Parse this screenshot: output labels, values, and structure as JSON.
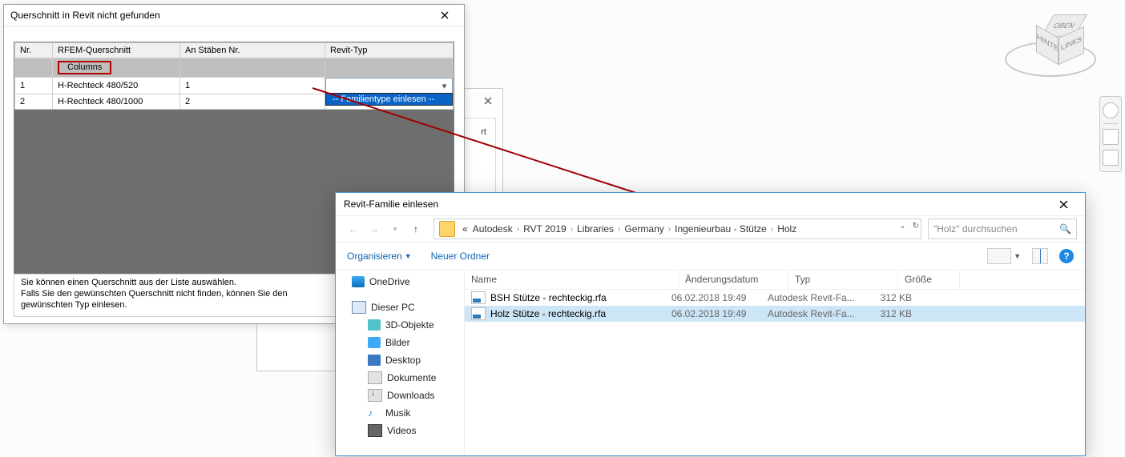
{
  "viewcube": {
    "top": "OBEN",
    "left": "HINTEN",
    "right": "LINKS"
  },
  "dialog1": {
    "title": "Querschnitt in Revit nicht gefunden",
    "columns": {
      "nr": "Nr.",
      "rfem": "RFEM-Querschnitt",
      "staebe": "An Stäben Nr.",
      "revit": "Revit-Typ"
    },
    "group_label": "Columns",
    "rows": [
      {
        "nr": "1",
        "rfem": "H-Rechteck 480/520",
        "staebe": "1"
      },
      {
        "nr": "2",
        "rfem": "H-Rechteck 480/1000",
        "staebe": "2"
      }
    ],
    "dropdown_item": "-- Familientype einlesen --",
    "footer": "Sie können einen Querschnitt aus der Liste auswählen.\nFalls Sie den gewünschten Querschnitt nicht finden, können Sie den gewünschten Typ einlesen."
  },
  "bgwin": {
    "rt": "rt"
  },
  "dialog2": {
    "title": "Revit-Familie einlesen",
    "breadcrumb": [
      "«",
      "Autodesk",
      "RVT 2019",
      "Libraries",
      "Germany",
      "Ingenieurbau - Stütze",
      "Holz"
    ],
    "search_placeholder": "\"Holz\" durchsuchen",
    "organize": "Organisieren",
    "new_folder": "Neuer Ordner",
    "help": "?",
    "tree": {
      "onedrive": "OneDrive",
      "this_pc": "Dieser PC",
      "objects3d": "3D-Objekte",
      "pictures": "Bilder",
      "desktop": "Desktop",
      "documents": "Dokumente",
      "downloads": "Downloads",
      "music": "Musik",
      "videos": "Videos"
    },
    "list_head": {
      "name": "Name",
      "date": "Änderungsdatum",
      "type": "Typ",
      "size": "Größe"
    },
    "files": [
      {
        "name": "BSH Stütze - rechteckig.rfa",
        "date": "06.02.2018 19:49",
        "type": "Autodesk Revit-Fa...",
        "size": "312 KB",
        "selected": false
      },
      {
        "name": "Holz Stütze - rechteckig.rfa",
        "date": "06.02.2018 19:49",
        "type": "Autodesk Revit-Fa...",
        "size": "312 KB",
        "selected": true
      }
    ]
  }
}
